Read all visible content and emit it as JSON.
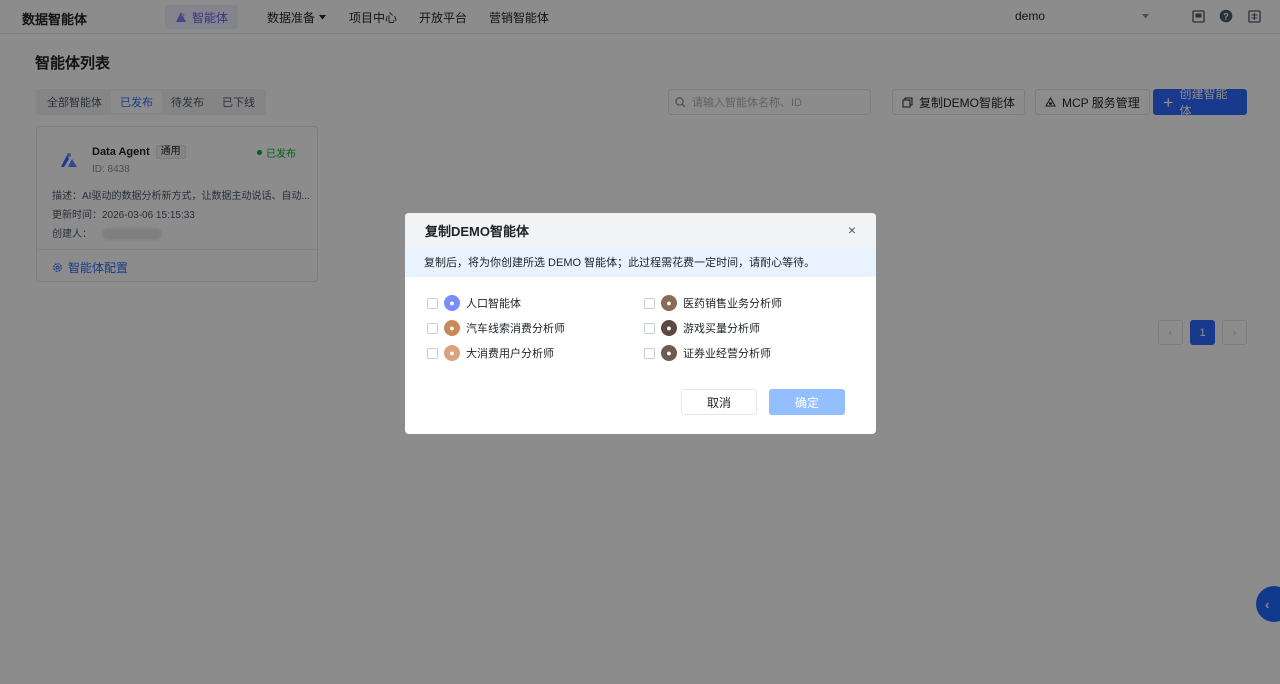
{
  "topbar": {
    "brand": "数据智能体",
    "nav": {
      "agent": "智能体",
      "data_prep": "数据准备",
      "project": "项目中心",
      "open_platform": "开放平台",
      "marketing": "营销智能体"
    },
    "user": "demo"
  },
  "page": {
    "title": "智能体列表",
    "tabs": [
      "全部智能体",
      "已发布",
      "待发布",
      "已下线"
    ],
    "active_tab": "已发布",
    "search_placeholder": "请输入智能体名称、ID",
    "copy_demo_button": "复制DEMO智能体",
    "mcp_button": "MCP 服务管理",
    "create_button": "创建智能体"
  },
  "card": {
    "name": "Data Agent",
    "tag": "通用",
    "status": "已发布",
    "id": "ID: 8438",
    "description": "描述：AI驱动的数据分析新方式，让数据主动说话、自动...",
    "updated": "更新时间：2026-03-06 15:15:33",
    "creator_label": "创建人：",
    "config_link": "智能体配置"
  },
  "pagination": {
    "prev": "‹",
    "page": "1",
    "next": "›"
  },
  "float_button": "‹",
  "modal": {
    "title": "复制DEMO智能体",
    "close": "×",
    "notice": "复制后，将为你创建所选 DEMO 智能体；此过程需花费一定时间，请耐心等待。",
    "options": [
      {
        "label": "人口智能体",
        "avatar_color": "#7b8cff"
      },
      {
        "label": "医药销售业务分析师",
        "avatar_color": "#8a6a55"
      },
      {
        "label": "汽车线索消费分析师",
        "avatar_color": "#c98a5a"
      },
      {
        "label": "游戏买量分析师",
        "avatar_color": "#5b4a44"
      },
      {
        "label": "大消费用户分析师",
        "avatar_color": "#d9a27d"
      },
      {
        "label": "证券业经营分析师",
        "avatar_color": "#6d5a50"
      }
    ],
    "cancel": "取消",
    "confirm": "确定"
  },
  "colors": {
    "primary": "#2f6bff",
    "published_green": "#00b42a",
    "agent_purple": "#6b5cf6"
  }
}
